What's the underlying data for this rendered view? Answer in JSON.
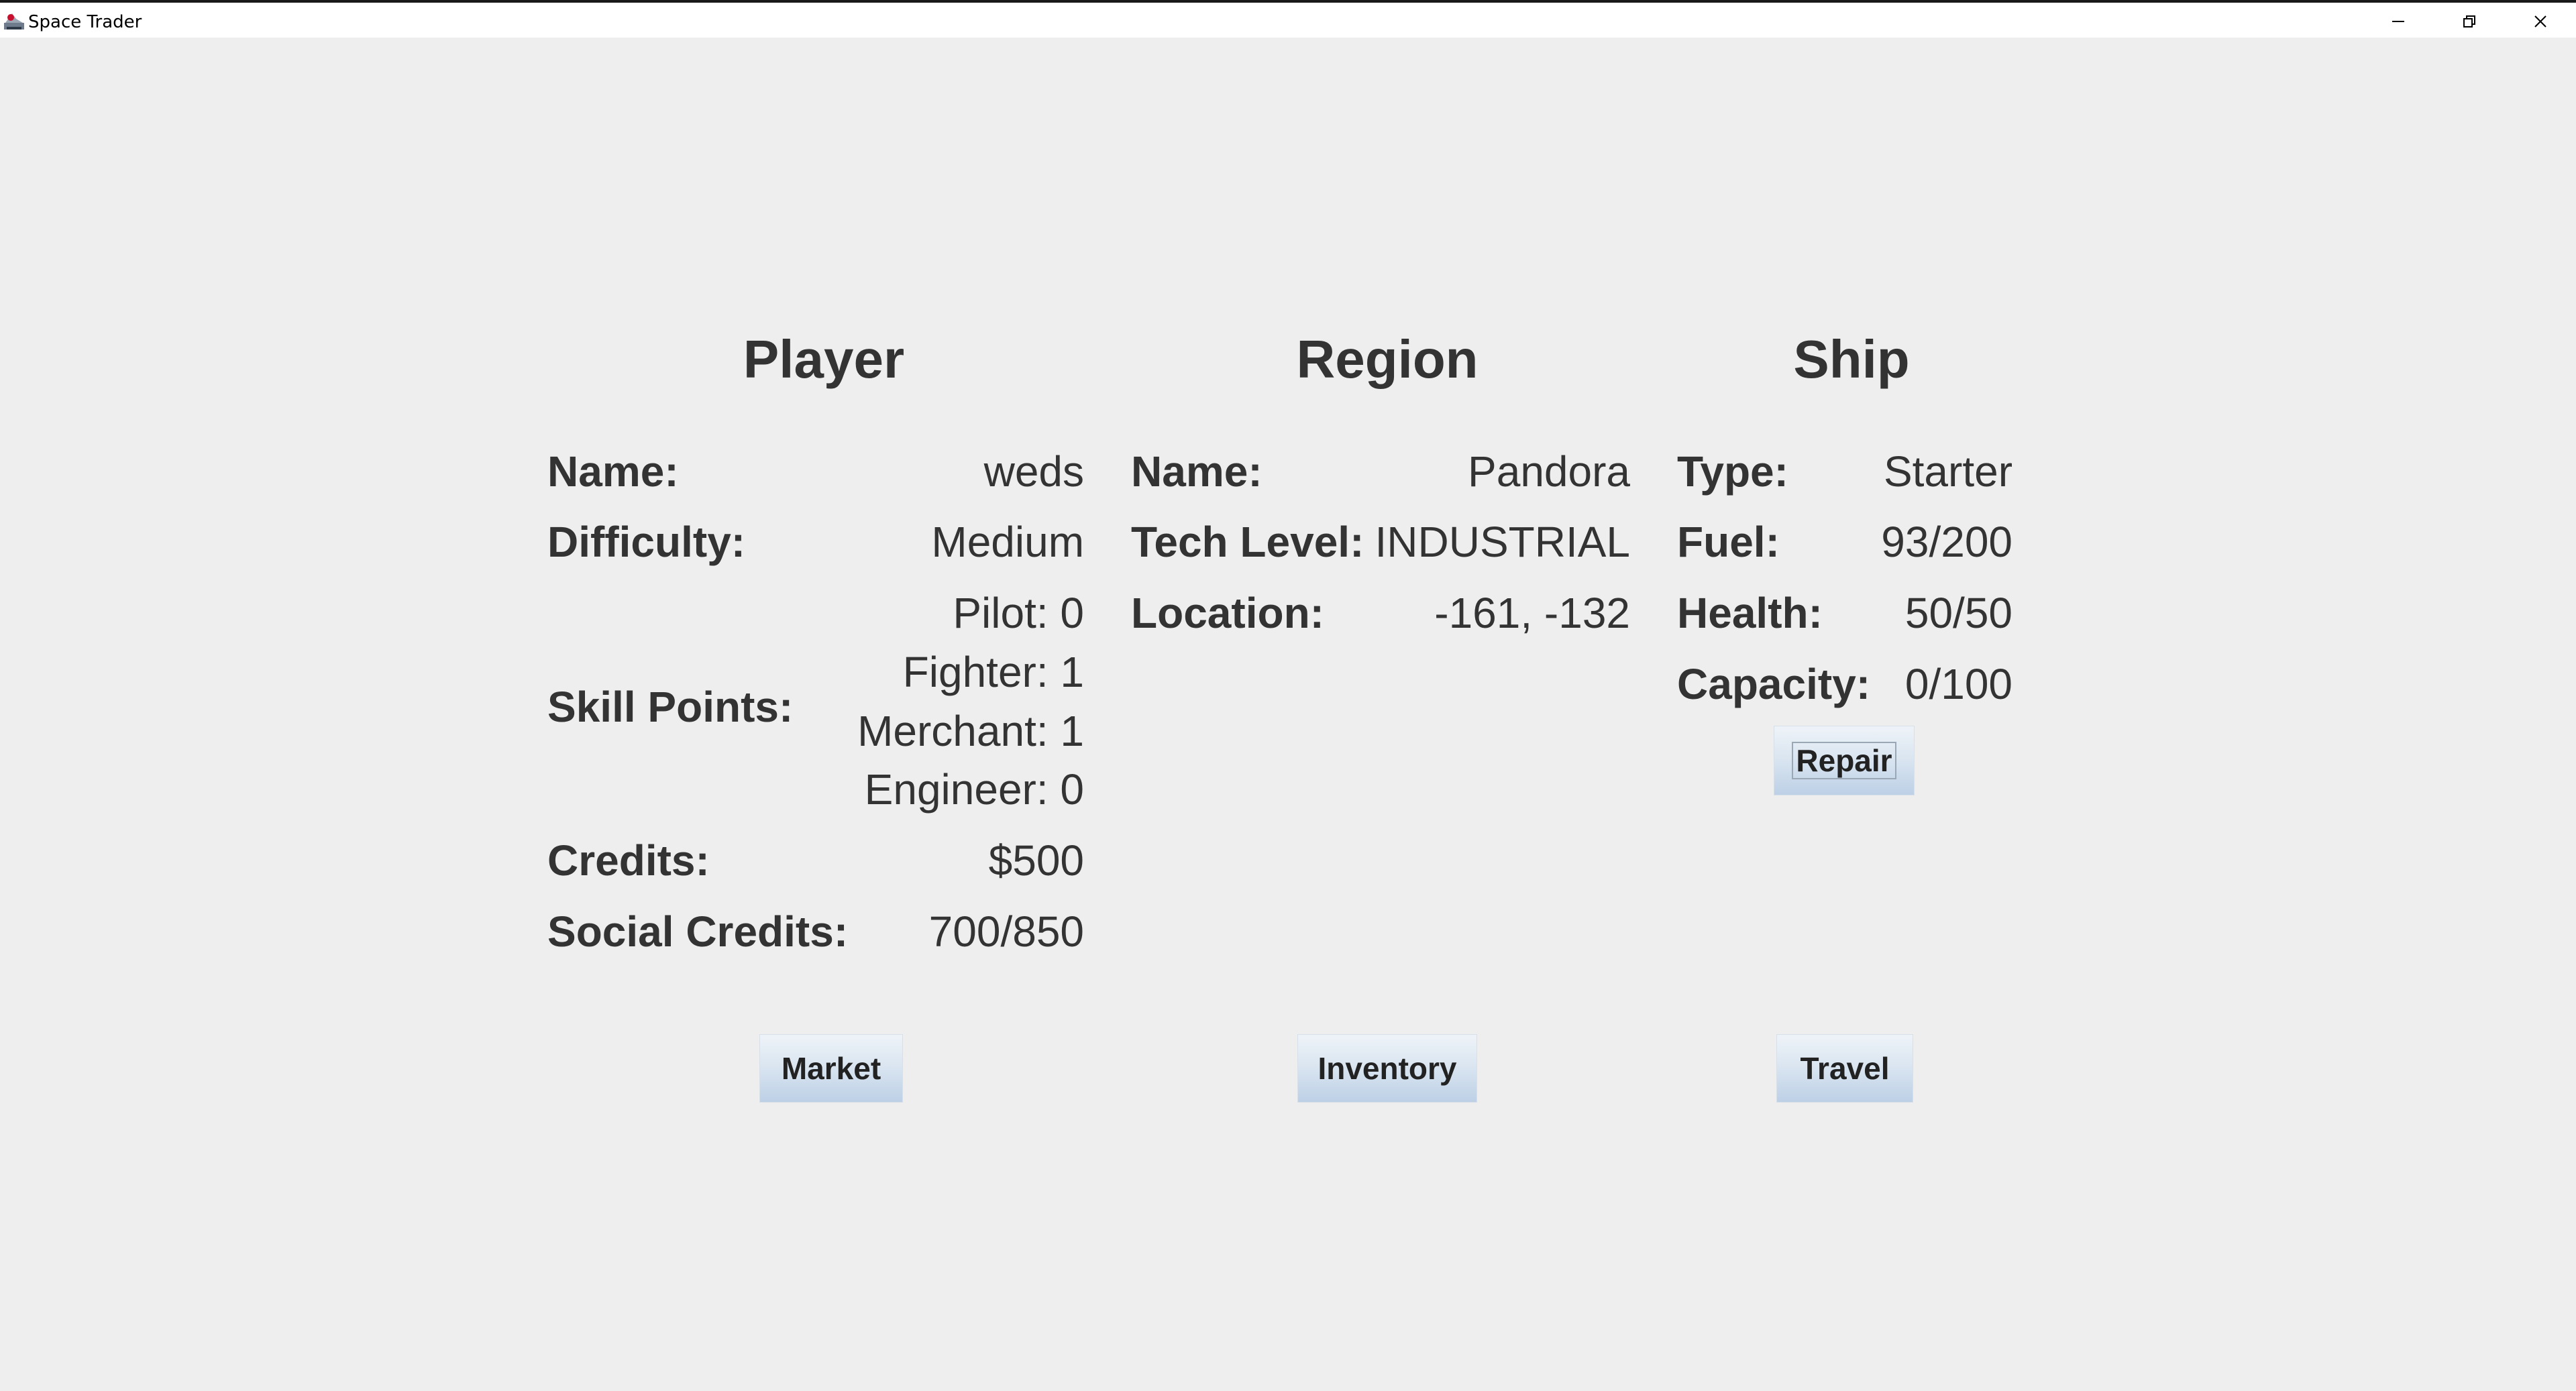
{
  "window": {
    "title": "Space Trader",
    "app_icon": "space-trader-icon",
    "controls": {
      "minimize_icon": "minimize-icon",
      "maximize_icon": "restore-icon",
      "close_icon": "close-icon"
    }
  },
  "player": {
    "heading": "Player",
    "name_label": "Name:",
    "name_value": "weds",
    "difficulty_label": "Difficulty:",
    "difficulty_value": "Medium",
    "skill_points_label": "Skill Points:",
    "skills": {
      "pilot": "Pilot: 0",
      "fighter": "Fighter: 1",
      "merchant": "Merchant: 1",
      "engineer": "Engineer: 0"
    },
    "credits_label": "Credits:",
    "credits_value": "$500",
    "social_credits_label": "Social Credits:",
    "social_credits_value": "700/850"
  },
  "region": {
    "heading": "Region",
    "name_label": "Name:",
    "name_value": "Pandora",
    "tech_level_label": "Tech Level:",
    "tech_level_value": "INDUSTRIAL",
    "location_label": "Location:",
    "location_value": "-161, -132"
  },
  "ship": {
    "heading": "Ship",
    "type_label": "Type:",
    "type_value": "Starter",
    "fuel_label": "Fuel:",
    "fuel_value": "93/200",
    "health_label": "Health:",
    "health_value": "50/50",
    "capacity_label": "Capacity:",
    "capacity_value": "0/100",
    "repair_button": "Repair"
  },
  "actions": {
    "market_button": "Market",
    "inventory_button": "Inventory",
    "travel_button": "Travel"
  }
}
